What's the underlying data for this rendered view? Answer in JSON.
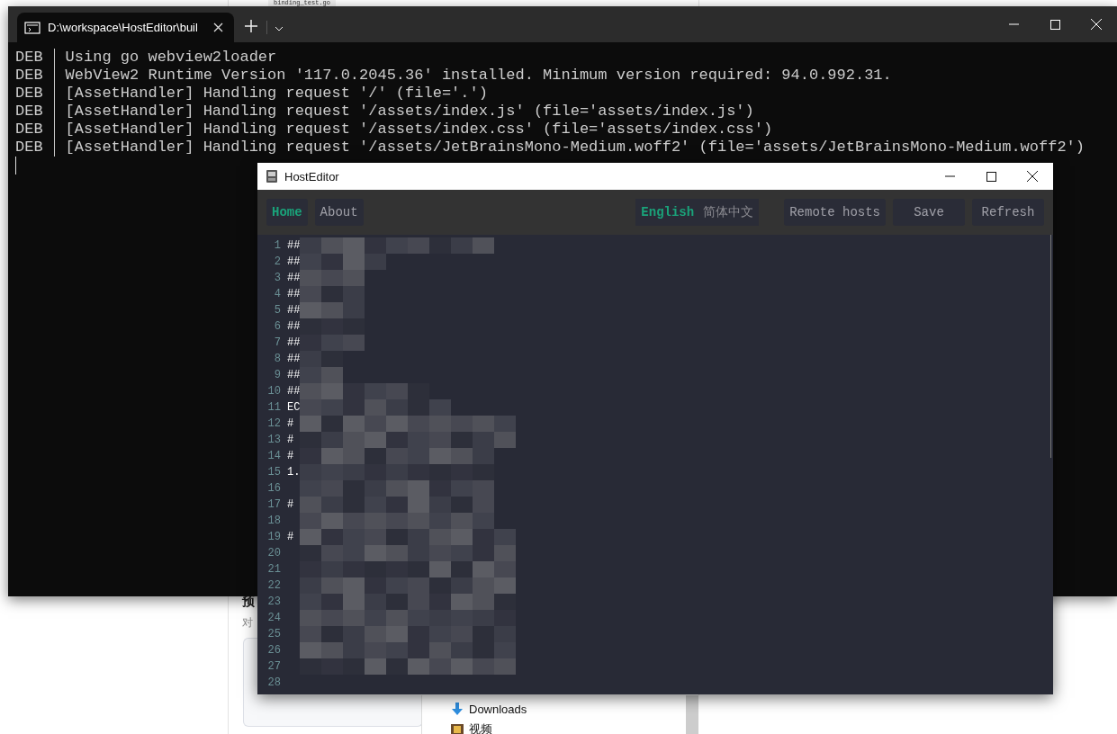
{
  "background_page": {
    "file_tab": "binding_test.go",
    "heading": "预",
    "subtext": "对",
    "folders": [
      {
        "name": "Downloads",
        "kind": "download"
      },
      {
        "name": "视频",
        "kind": "video"
      }
    ]
  },
  "terminal": {
    "tab_title": "D:\\workspace\\HostEditor\\buil",
    "lines": [
      {
        "level": "DEB",
        "message": "Using go webview2loader"
      },
      {
        "level": "DEB",
        "message": "WebView2 Runtime Version '117.0.2045.36' installed. Minimum version required: 94.0.992.31."
      },
      {
        "level": "DEB",
        "message": "[AssetHandler] Handling request '/' (file='.')"
      },
      {
        "level": "DEB",
        "message": "[AssetHandler] Handling request '/assets/index.js' (file='assets/index.js')"
      },
      {
        "level": "DEB",
        "message": "[AssetHandler] Handling request '/assets/index.css' (file='assets/index.css')"
      },
      {
        "level": "DEB",
        "message": "[AssetHandler] Handling request '/assets/JetBrainsMono-Medium.woff2' (file='assets/JetBrainsMono-Medium.woff2')"
      }
    ]
  },
  "app": {
    "title": "HostEditor",
    "nav": [
      {
        "label": "Home",
        "selected": true
      },
      {
        "label": "About",
        "selected": false
      }
    ],
    "languages": [
      {
        "label": "English",
        "selected": true
      },
      {
        "label": "简体中文",
        "selected": false
      }
    ],
    "actions": [
      "Remote hosts",
      "Save",
      "Refresh"
    ],
    "editor_lines": [
      {
        "number": "1",
        "text": "##"
      },
      {
        "number": "2",
        "text": "##"
      },
      {
        "number": "3",
        "text": "##"
      },
      {
        "number": "4",
        "text": "##"
      },
      {
        "number": "5",
        "text": "##"
      },
      {
        "number": "6",
        "text": "##"
      },
      {
        "number": "7",
        "text": "##"
      },
      {
        "number": "8",
        "text": "##"
      },
      {
        "number": "9",
        "text": "##"
      },
      {
        "number": "10",
        "text": "##"
      },
      {
        "number": "11",
        "text": "EC"
      },
      {
        "number": "12",
        "text": "#"
      },
      {
        "number": "13",
        "text": "#"
      },
      {
        "number": "14",
        "text": "#"
      },
      {
        "number": "15",
        "text": "1."
      },
      {
        "number": "16"
      },
      {
        "number": "17",
        "text": "#"
      },
      {
        "number": "18"
      },
      {
        "number": "19",
        "text": "#"
      },
      {
        "number": "20"
      },
      {
        "number": "21"
      },
      {
        "number": "22"
      },
      {
        "number": "23"
      },
      {
        "number": "24"
      },
      {
        "number": "25"
      },
      {
        "number": "26"
      },
      {
        "number": "27"
      },
      {
        "number": "28"
      }
    ]
  }
}
